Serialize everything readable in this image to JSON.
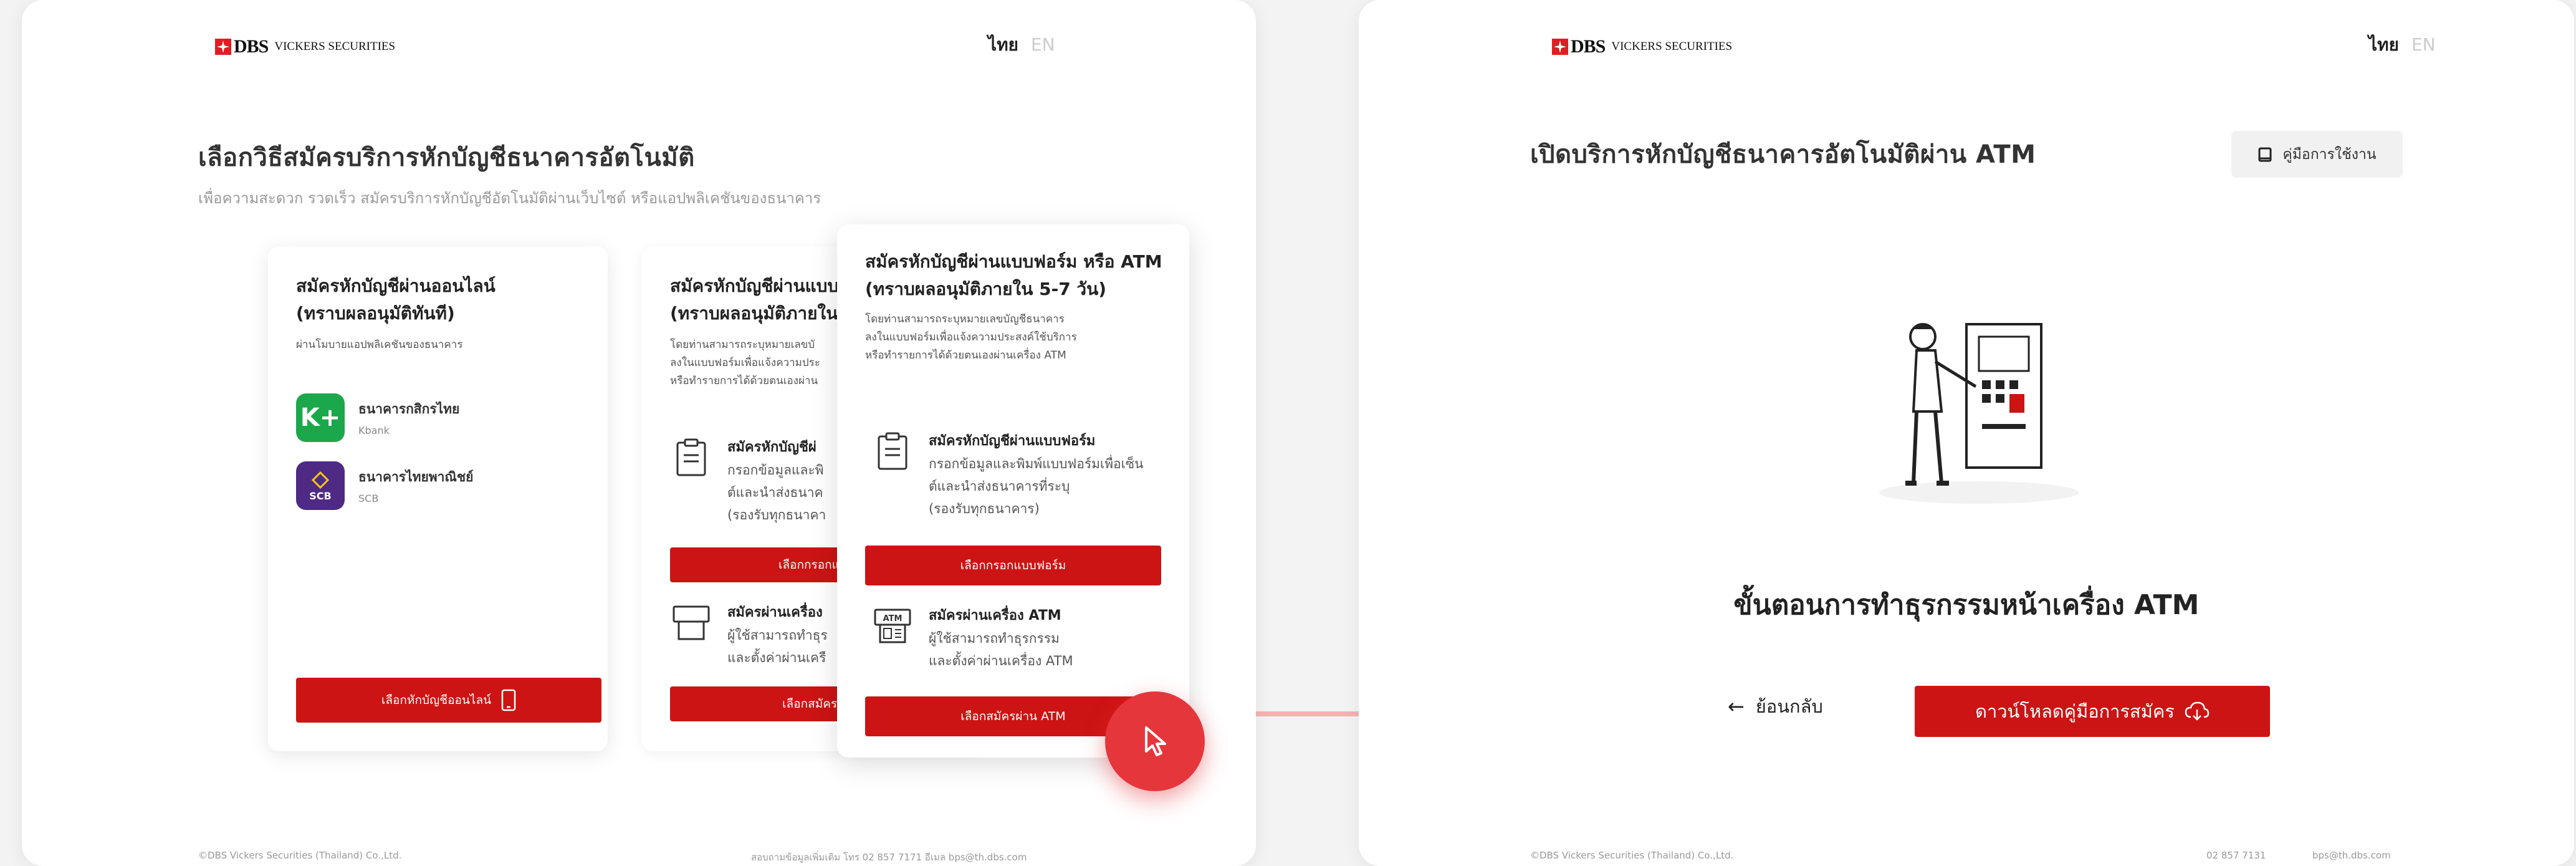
{
  "brand": {
    "name": "DBS",
    "suffix": "VICKERS SECURITIES",
    "red": "#cc1414"
  },
  "lang": {
    "thai": "ไทย",
    "en": "EN"
  },
  "left": {
    "title": "เลือกวิธีสมัครบริการหักบัญชีธนาคารอัตโนมัติ",
    "subtitle": "เพื่อความสะดวก รวดเร็ว สมัครบริการหักบัญชีอัตโนมัติผ่านเว็บไซต์ หรือแอปพลิเคชันของธนาคาร",
    "online_card": {
      "title1": "สมัครหักบัญชีผ่านออนไลน์",
      "title2": "(ทราบผลอนุมัติทันที)",
      "desc": "ผ่านโมบายแอปพลิเคชันของธนาคาร",
      "banks": [
        {
          "name": "ธนาคารกสิกรไทย",
          "code": "Kbank",
          "logo_text": "K+",
          "color": "#1ba84b"
        },
        {
          "name": "ธนาคารไทยพาณิชย์",
          "code": "SCB",
          "logo_text": "SCB",
          "color": "#4e2a84"
        }
      ],
      "button": "เลือกหักบัญชีออนไลน์"
    },
    "behind_card": {
      "title1": "สมัครหักบัญชีผ่านแบบ",
      "title2": "(ทราบผลอนุมัติภายใน",
      "desc1": "โดยท่านสามารถระบุหมายเลขบั",
      "desc2": "ลงในแบบฟอร์มเพื่อแจ้งความประ",
      "desc3": "หรือทำรายการได้ด้วยตนเองผ่าน",
      "opt1_title": "สมัครหักบัญชีผ่",
      "opt1_desc1": "กรอกข้อมูลและพิ",
      "opt1_desc2": "ต์และนำส่งธนาค",
      "opt1_desc3": "(รองรับทุกธนาคา",
      "btn1": "เลือกกรอกแบบ",
      "opt2_title": "สมัครผ่านเครื่อง",
      "opt2_desc1": "ผู้ใช้สามารถทำธุร",
      "opt2_desc2": "และตั้งค่าผ่านเครื",
      "btn2": "เลือกสมัครผ่า"
    },
    "front_card": {
      "title1": "สมัครหักบัญชีผ่านแบบฟอร์ม หรือ ATM",
      "title2": "(ทราบผลอนุมัติภายใน 5-7 วัน)",
      "desc1": "โดยท่านสามารถระบุหมายเลขบัญชีธนาคาร",
      "desc2": "ลงในแบบฟอร์มเพื่อแจ้งความประสงค์ใช้บริการ",
      "desc3": "หรือทำรายการได้ด้วยตนเองผ่านเครื่อง ATM",
      "opt1_title": "สมัครหักบัญชีผ่านแบบฟอร์ม",
      "opt1_desc1": "กรอกข้อมูลและพิมพ์แบบฟอร์มเพื่อเซ็น",
      "opt1_desc2": "ต์และนำส่งธนาคารที่ระบุ",
      "opt1_desc3": "(รองรับทุกธนาคาร)",
      "btn1": "เลือกกรอกแบบฟอร์ม",
      "opt2_title": "สมัครผ่านเครื่อง ATM",
      "opt2_desc1": "ผู้ใช้สามารถทำธุรกรรม",
      "opt2_desc2": "และตั้งค่าผ่านเครื่อง ATM",
      "btn2": "เลือกสมัครผ่าน ATM"
    },
    "footer_left": "©DBS Vickers Securities (Thailand) Co.,Ltd.",
    "footer_right": "สอบถามข้อมูลเพิ่มเติม โทร 02 857 7171 อีเมล bps@th.dbs.com"
  },
  "right": {
    "title": "เปิดบริการหักบัญชีธนาคารอัตโนมัติผ่าน ATM",
    "guide": "คู่มือการใช้งาน",
    "heading": "ขั้นตอนการทำธุรกรรมหน้าเครื่อง ATM",
    "back": "ย้อนกลับ",
    "download": "ดาวน์โหลดคู่มือการสมัคร",
    "footer_left": "©DBS Vickers Securities (Thailand) Co.,Ltd.",
    "footer_phone": "02 857 7131",
    "footer_email": "bps@th.dbs.com"
  }
}
